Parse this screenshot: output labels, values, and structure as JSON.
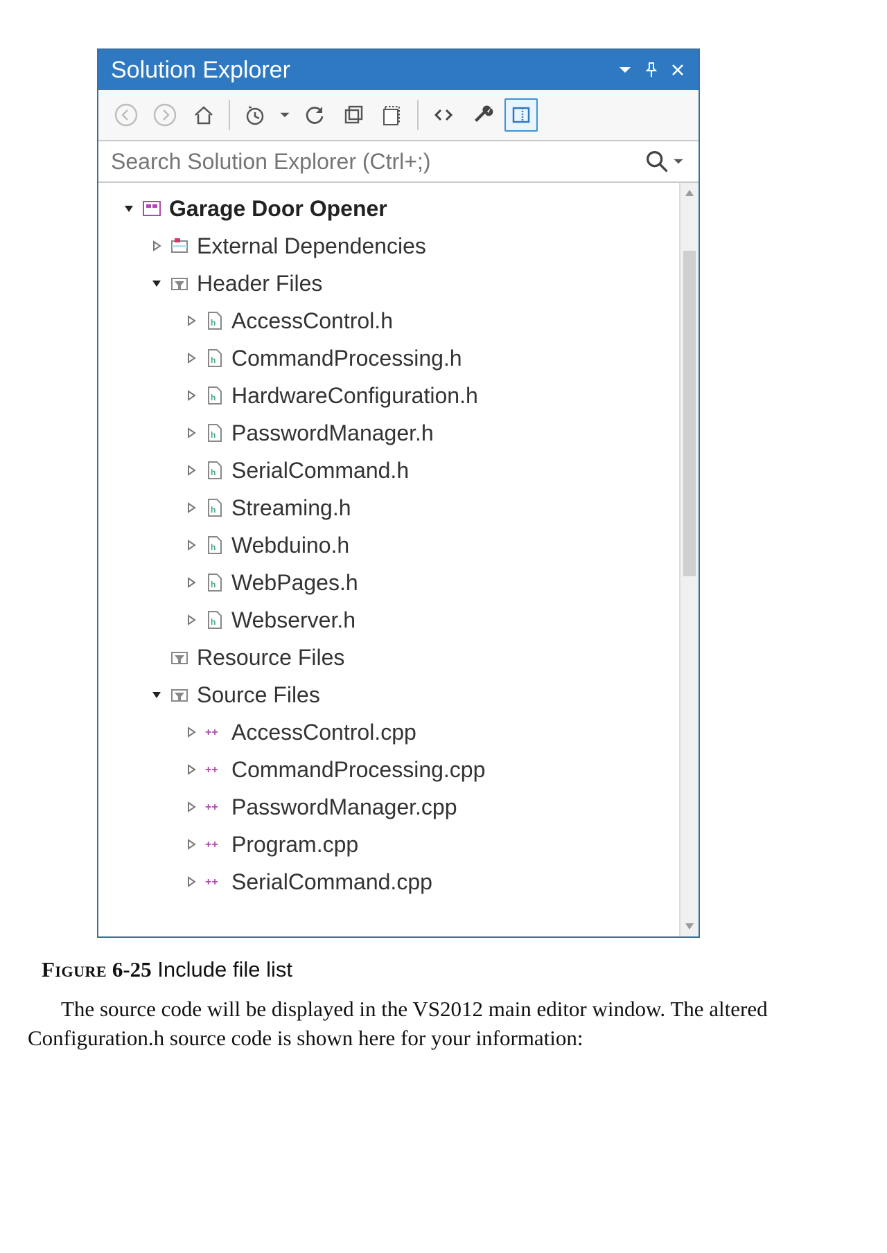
{
  "panel": {
    "title": "Solution Explorer"
  },
  "search": {
    "placeholder": "Search Solution Explorer (Ctrl+;)"
  },
  "tree": {
    "project": "Garage Door Opener",
    "folders": {
      "externalDeps": "External Dependencies",
      "headerFiles": "Header Files",
      "resourceFiles": "Resource Files",
      "sourceFiles": "Source Files"
    },
    "headers": [
      "AccessControl.h",
      "CommandProcessing.h",
      "HardwareConfiguration.h",
      "PasswordManager.h",
      "SerialCommand.h",
      "Streaming.h",
      "Webduino.h",
      "WebPages.h",
      "Webserver.h"
    ],
    "sources": [
      "AccessControl.cpp",
      "CommandProcessing.cpp",
      "PasswordManager.cpp",
      "Program.cpp",
      "SerialCommand.cpp"
    ]
  },
  "caption": {
    "figlabel": "Figure",
    "fignum": "6-25",
    "figtext": "Include file list"
  },
  "body": "The source code will be displayed in the VS2012 main editor window. The altered Configuration.h source code is shown here for your information:"
}
